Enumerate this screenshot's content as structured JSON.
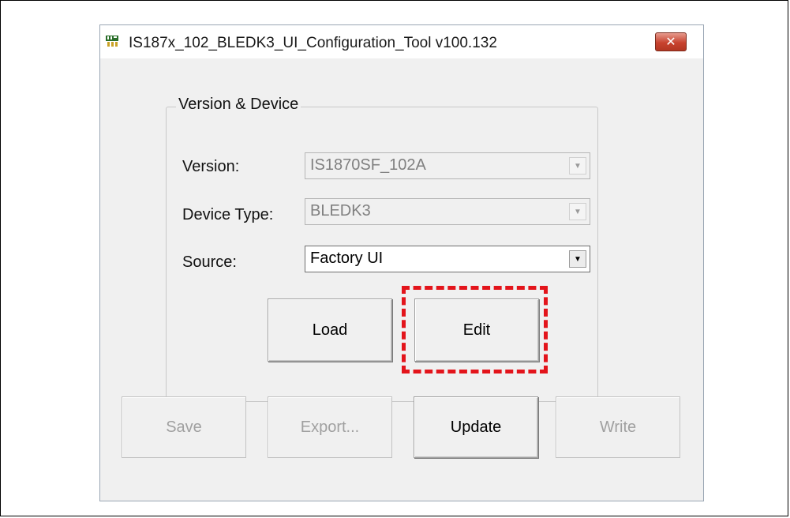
{
  "window": {
    "title": "IS187x_102_BLEDK3_UI_Configuration_Tool v100.132",
    "icon": "app-chip-icon",
    "close_label": "✕"
  },
  "group": {
    "label": "Version & Device"
  },
  "fields": {
    "version": {
      "label": "Version:",
      "value": "IS1870SF_102A",
      "enabled": false
    },
    "device_type": {
      "label": "Device Type:",
      "value": "BLEDK3",
      "enabled": false
    },
    "source": {
      "label": "Source:",
      "value": "Factory UI",
      "enabled": true
    }
  },
  "buttons": {
    "load": "Load",
    "edit": "Edit",
    "save": "Save",
    "export": "Export...",
    "update": "Update",
    "write": "Write"
  },
  "colors": {
    "highlight": "#e3141b",
    "close_button": "#c8432f"
  }
}
